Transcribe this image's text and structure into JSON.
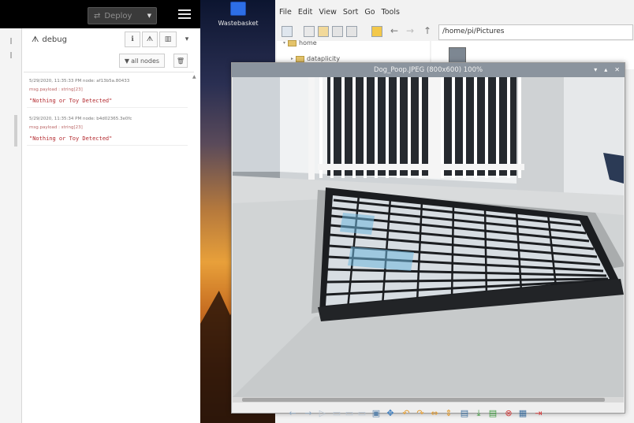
{
  "nodered": {
    "deploy_label": "Deploy",
    "debug_tab": "debug",
    "filter_label": "all nodes",
    "messages": [
      {
        "meta": "5/29/2020, 11:35:33 PM  node: af13b5a.80433",
        "payload": "msg.payload : string[23]",
        "value": "\"Nothing or Toy Detected\""
      },
      {
        "meta": "5/29/2020, 11:35:34 PM  node: b4d02365.3e0fc",
        "payload": "msg.payload : string[23]",
        "value": "\"Nothing or Toy Detected\""
      }
    ]
  },
  "desktop": {
    "wastebasket_label": "Wastebasket"
  },
  "file_manager": {
    "menu": [
      "File",
      "Edit",
      "View",
      "Sort",
      "Go",
      "Tools"
    ],
    "path": "/home/pi/Pictures",
    "tree": [
      "home",
      "dataplicity"
    ]
  },
  "viewer": {
    "title": "Dog_Poop.JPEG (800x600) 100%"
  }
}
